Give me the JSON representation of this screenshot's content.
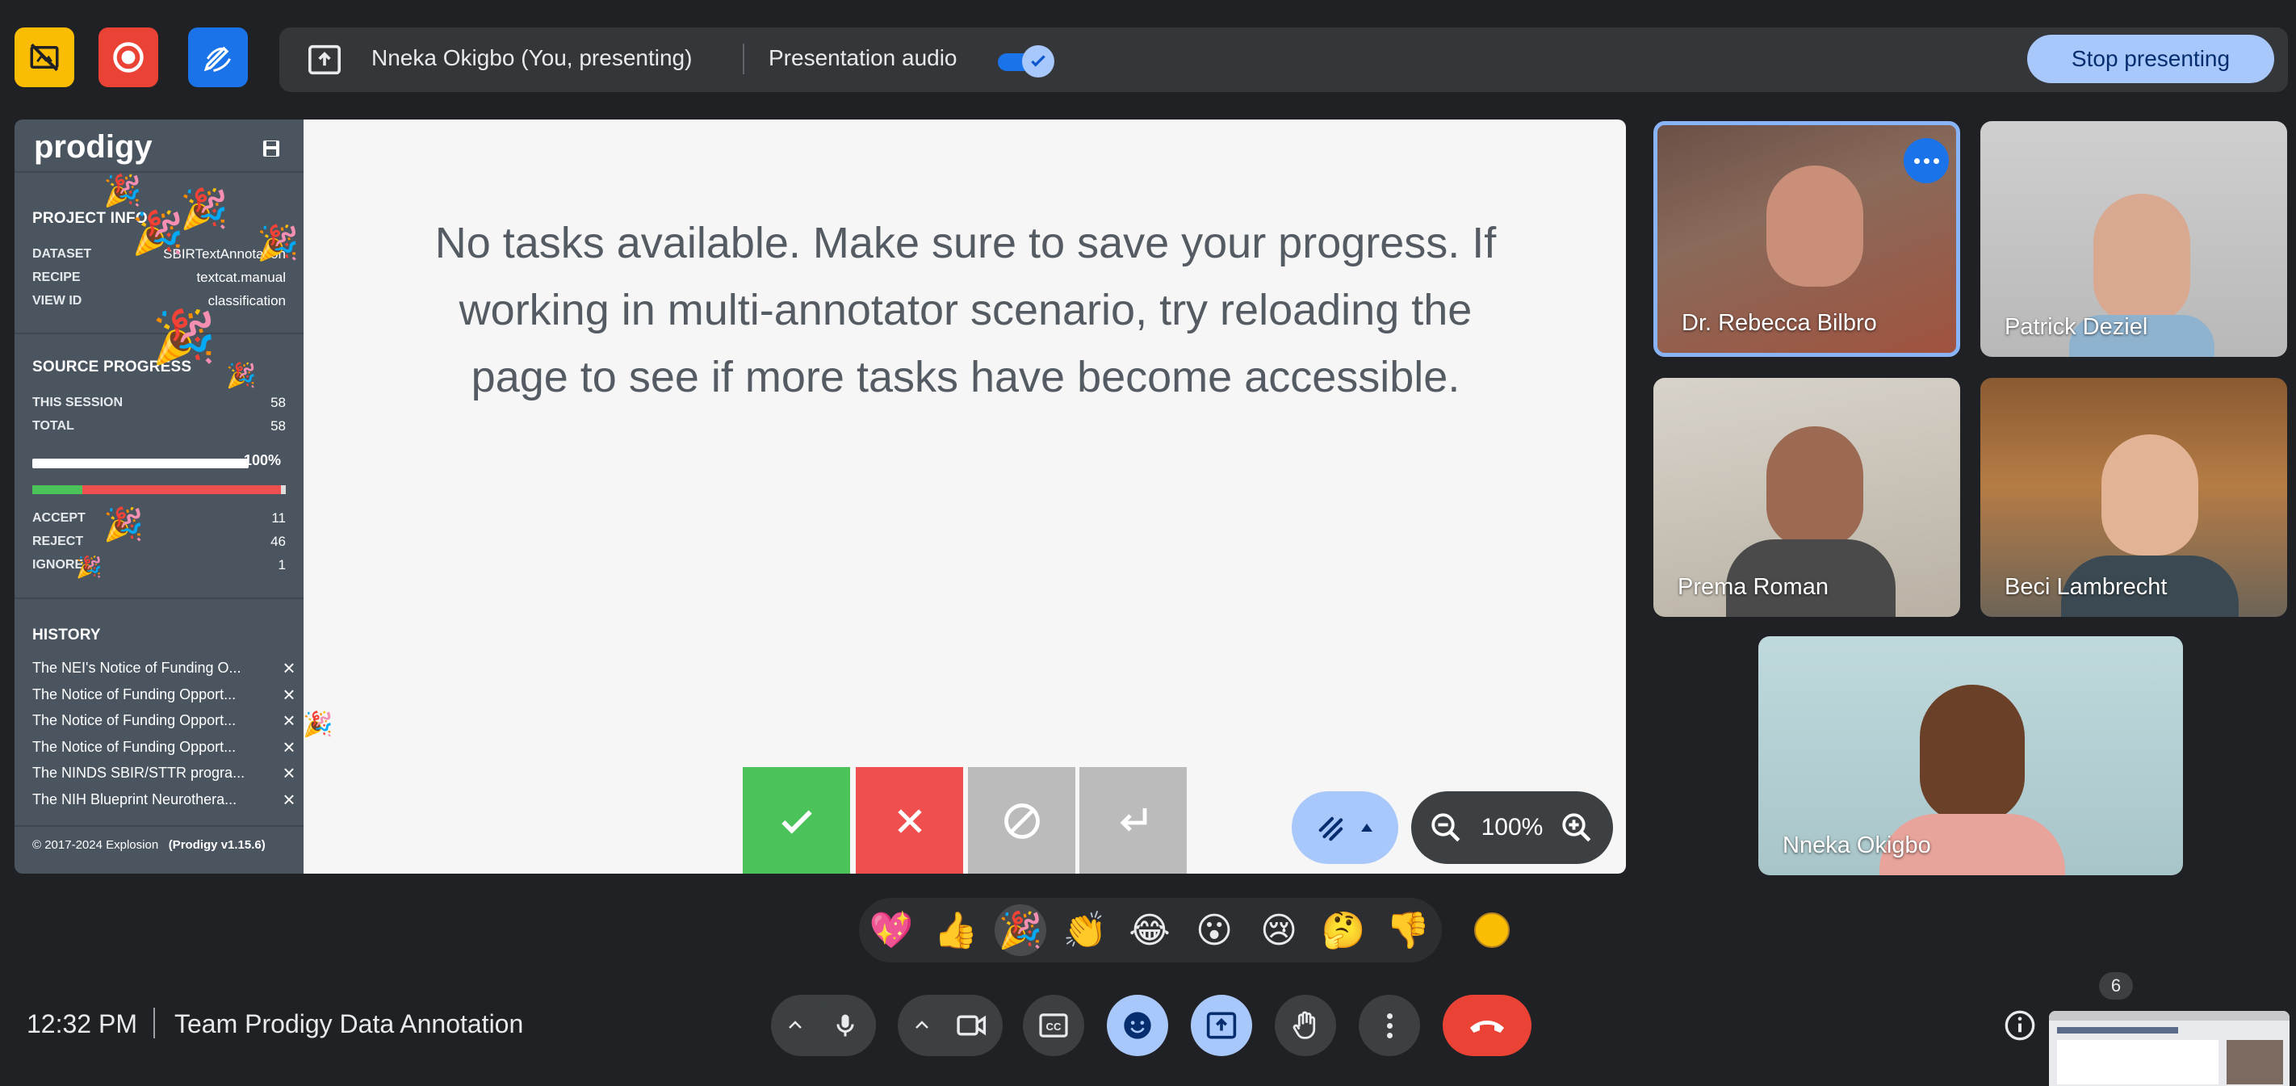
{
  "meeting": {
    "time": "12:32 PM",
    "title": "Team Prodigy Data Annotation",
    "participants_count": "6"
  },
  "presenting_bar": {
    "presenter_label": "Nneka Okigbo (You, presenting)",
    "audio_label": "Presentation audio",
    "audio_enabled": true,
    "stop_label": "Stop presenting"
  },
  "prodigy": {
    "logo": "prodigy",
    "project_info": {
      "heading": "PROJECT INFO",
      "rows": [
        {
          "key": "DATASET",
          "value": "SBIRTextAnnotation"
        },
        {
          "key": "RECIPE",
          "value": "textcat.manual"
        },
        {
          "key": "VIEW ID",
          "value": "classification"
        }
      ]
    },
    "source_progress": {
      "heading": "SOURCE PROGRESS",
      "rows": [
        {
          "key": "THIS SESSION",
          "value": "58"
        },
        {
          "key": "TOTAL",
          "value": "58"
        }
      ],
      "progress_label": "100%",
      "progress_fraction": 1.0
    },
    "counts": [
      {
        "key": "ACCEPT",
        "value": "11"
      },
      {
        "key": "REJECT",
        "value": "46"
      },
      {
        "key": "IGNORE",
        "value": "1"
      }
    ],
    "history": {
      "heading": "HISTORY",
      "items": [
        "The NEI's Notice of Funding O...",
        "The Notice of Funding Opport...",
        "The Notice of Funding Opport...",
        "The Notice of Funding Opport...",
        "The NINDS SBIR/STTR progra...",
        "The NIH Blueprint Neurothera..."
      ]
    },
    "footer_copyright": "© 2017-2024 Explosion",
    "footer_version": "(Prodigy v1.15.6)",
    "message": "No tasks available. Make sure to save your progress. If working in multi-annotator scenario, try reloading the page to see if more tasks have become accessible.",
    "zoom": "100%"
  },
  "participants": [
    {
      "name": "Dr. Rebecca Bilbro"
    },
    {
      "name": "Patrick Deziel"
    },
    {
      "name": "Prema Roman"
    },
    {
      "name": "Beci Lambrecht"
    },
    {
      "name": "Nneka Okigbo"
    }
  ],
  "reactions": [
    "💖",
    "👍",
    "🎉",
    "👏",
    "😂",
    "😮",
    "😢",
    "🤔",
    "👎"
  ],
  "colors": {
    "accept": "#4cc35a",
    "reject": "#ef4f4f",
    "ignore": "#bbbbbb",
    "hangup": "#ea4335",
    "stop": "#a8c7fa",
    "active_control": "#a8c7fa"
  }
}
